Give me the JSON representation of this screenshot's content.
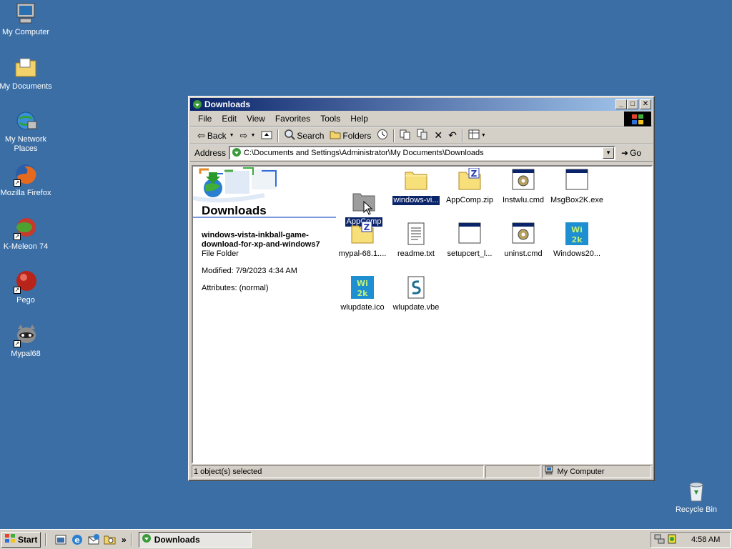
{
  "desktop": {
    "icons": [
      {
        "label": "My Computer",
        "icon": "my-computer-icon"
      },
      {
        "label": "My Documents",
        "icon": "my-documents-icon"
      },
      {
        "label": "My Network Places",
        "icon": "network-places-icon"
      },
      {
        "label": "Mozilla Firefox",
        "icon": "firefox-icon"
      },
      {
        "label": "K-Meleon 74",
        "icon": "kmeleon-icon"
      },
      {
        "label": "Pego",
        "icon": "pego-icon"
      },
      {
        "label": "Mypal68",
        "icon": "mypal-icon"
      },
      {
        "label": "Recycle Bin",
        "icon": "recycle-bin-icon"
      }
    ]
  },
  "window": {
    "title": "Downloads",
    "menu": [
      "File",
      "Edit",
      "View",
      "Favorites",
      "Tools",
      "Help"
    ],
    "toolbar": {
      "back": "Back",
      "search": "Search",
      "folders": "Folders"
    },
    "address": {
      "label": "Address",
      "value": "C:\\Documents and Settings\\Administrator\\My Documents\\Downloads",
      "go": "Go"
    },
    "left_pane": {
      "title": "Downloads",
      "selected_name": "windows-vista-inkball-game-download-for-xp-and-windows7",
      "selected_type": "File Folder",
      "modified": "Modified: 7/9/2023 4:34 AM",
      "attributes": "Attributes: (normal)"
    },
    "files": [
      {
        "name": "windows-vi...",
        "icon": "folder-icon"
      },
      {
        "name": "AppComp.zip",
        "icon": "zip-folder-icon"
      },
      {
        "name": "Instwlu.cmd",
        "icon": "cmd-script-icon"
      },
      {
        "name": "MsgBox2K.exe",
        "icon": "exe-window-icon"
      },
      {
        "name": "mypal-68.1....",
        "icon": "zip-folder-icon"
      },
      {
        "name": "readme.txt",
        "icon": "text-file-icon"
      },
      {
        "name": "setupcert_l...",
        "icon": "exe-window-icon"
      },
      {
        "name": "uninst.cmd",
        "icon": "cmd-script-icon"
      },
      {
        "name": "Windows20...",
        "icon": "win2k-image-icon"
      },
      {
        "name": "wlupdate.ico",
        "icon": "win2k-image-icon"
      },
      {
        "name": "wlupdate.vbe",
        "icon": "vbscript-file-icon"
      }
    ],
    "drag_item": {
      "name": "AppComp",
      "icon": "folder-drag-icon"
    },
    "status": {
      "selection": "1 object(s) selected",
      "zone": "My Computer"
    }
  },
  "taskbar": {
    "start": "Start",
    "task": "Downloads",
    "clock": "4:58 AM"
  }
}
